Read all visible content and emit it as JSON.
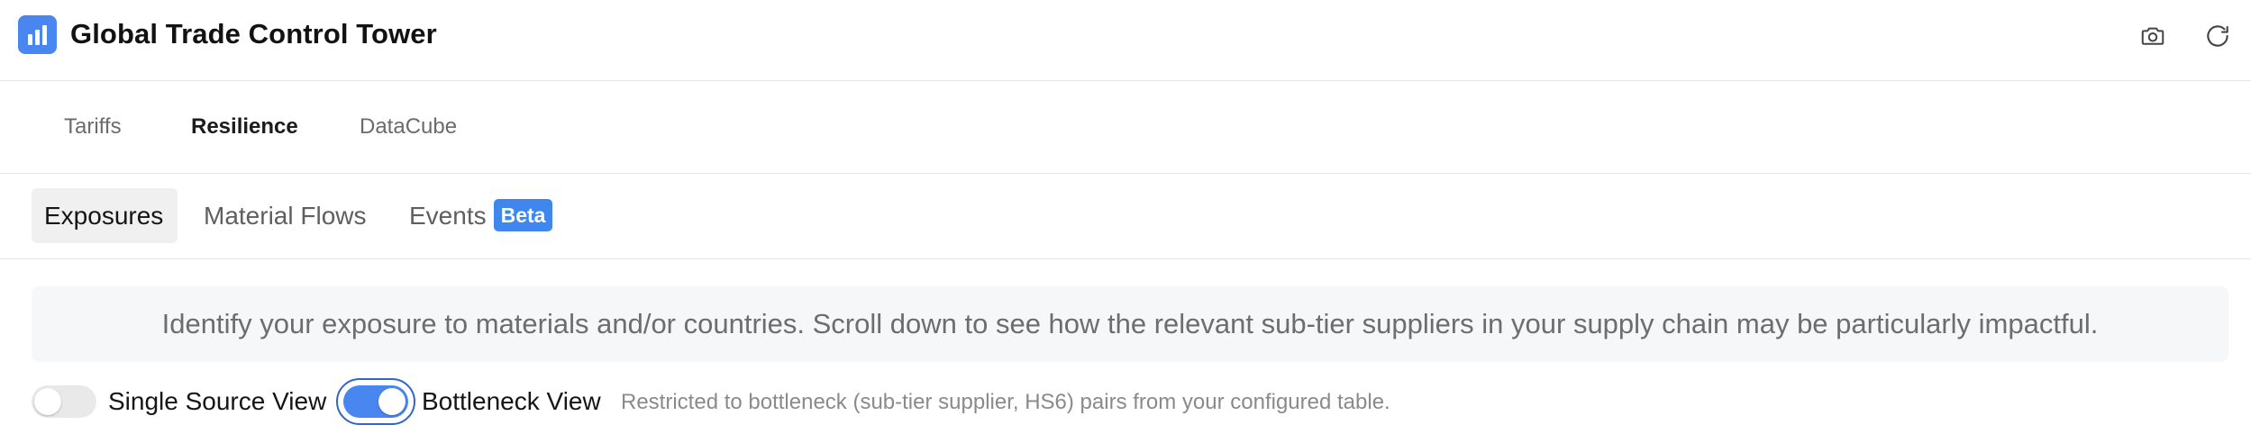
{
  "app": {
    "title": "Global Trade Control Tower",
    "logo_icon": "bar-chart-icon",
    "accent_color": "#4a86f0"
  },
  "toolbar": {
    "screenshot_icon": "camera-icon",
    "refresh_icon": "refresh-icon"
  },
  "module_tabs": [
    {
      "label": "Tariffs",
      "active": false
    },
    {
      "label": "Resilience",
      "active": true
    },
    {
      "label": "DataCube",
      "active": false
    }
  ],
  "sub_tabs": [
    {
      "label": "Exposures",
      "active": true
    },
    {
      "label": "Material Flows",
      "active": false
    },
    {
      "label": "Events",
      "active": false,
      "badge": "Beta"
    }
  ],
  "banner": {
    "text": "Identify your exposure to materials and/or countries. Scroll down to see how the relevant sub-tier suppliers in your supply chain may be particularly impactful."
  },
  "toggles": {
    "single_source": {
      "label": "Single Source View",
      "on": false
    },
    "bottleneck": {
      "label": "Bottleneck View",
      "on": true
    },
    "hint": "Restricted to bottleneck (sub-tier supplier, HS6) pairs from your configured table."
  }
}
